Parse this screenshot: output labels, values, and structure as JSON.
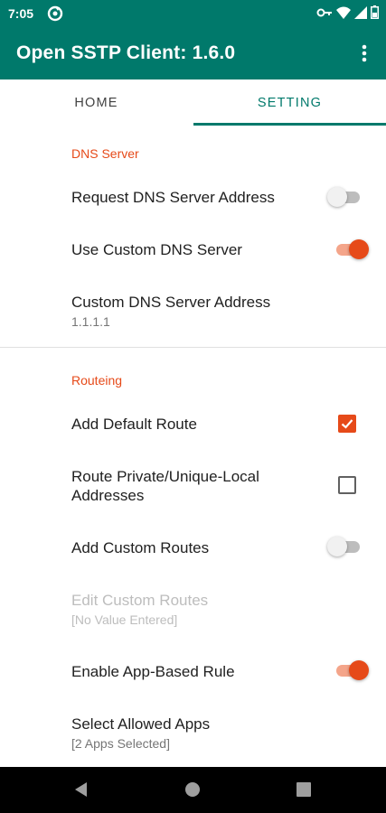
{
  "status_bar": {
    "time": "7:05",
    "icons": [
      "sync-icon",
      "vpn-key-icon",
      "wifi-icon",
      "signal-icon",
      "battery-icon"
    ]
  },
  "app_bar": {
    "title": "Open SSTP Client: 1.6.0",
    "menu_icon": "more-vert-icon",
    "color": "#00796b"
  },
  "tabs": [
    {
      "label": "HOME",
      "selected": false
    },
    {
      "label": "SETTING",
      "selected": true
    }
  ],
  "dns": {
    "header": "DNS Server",
    "request_dns": {
      "label": "Request DNS Server Address",
      "enabled": false
    },
    "use_custom_dns": {
      "label": "Use Custom DNS Server",
      "enabled": true
    },
    "custom_dns_address": {
      "label": "Custom DNS Server Address",
      "value": "1.1.1.1"
    }
  },
  "routing": {
    "header": "Routeing",
    "add_default_route": {
      "label": "Add Default Route",
      "checked": true
    },
    "route_private": {
      "label_line1": "Route Private/Unique-Local",
      "label_line2": "Addresses",
      "checked": false
    },
    "add_custom_routes": {
      "label": "Add Custom Routes",
      "enabled": false
    },
    "edit_custom_routes": {
      "label": "Edit Custom Routes",
      "value": "[No Value Entered]",
      "disabled": true
    },
    "enable_app_based_rule": {
      "label": "Enable App-Based Rule",
      "enabled": true
    },
    "select_allowed_apps": {
      "label": "Select Allowed Apps",
      "value": "[2 Apps Selected]"
    }
  },
  "accent_color": "#e64a19",
  "nav_bar": {
    "icons": [
      "back-icon",
      "home-icon",
      "recents-icon"
    ]
  }
}
